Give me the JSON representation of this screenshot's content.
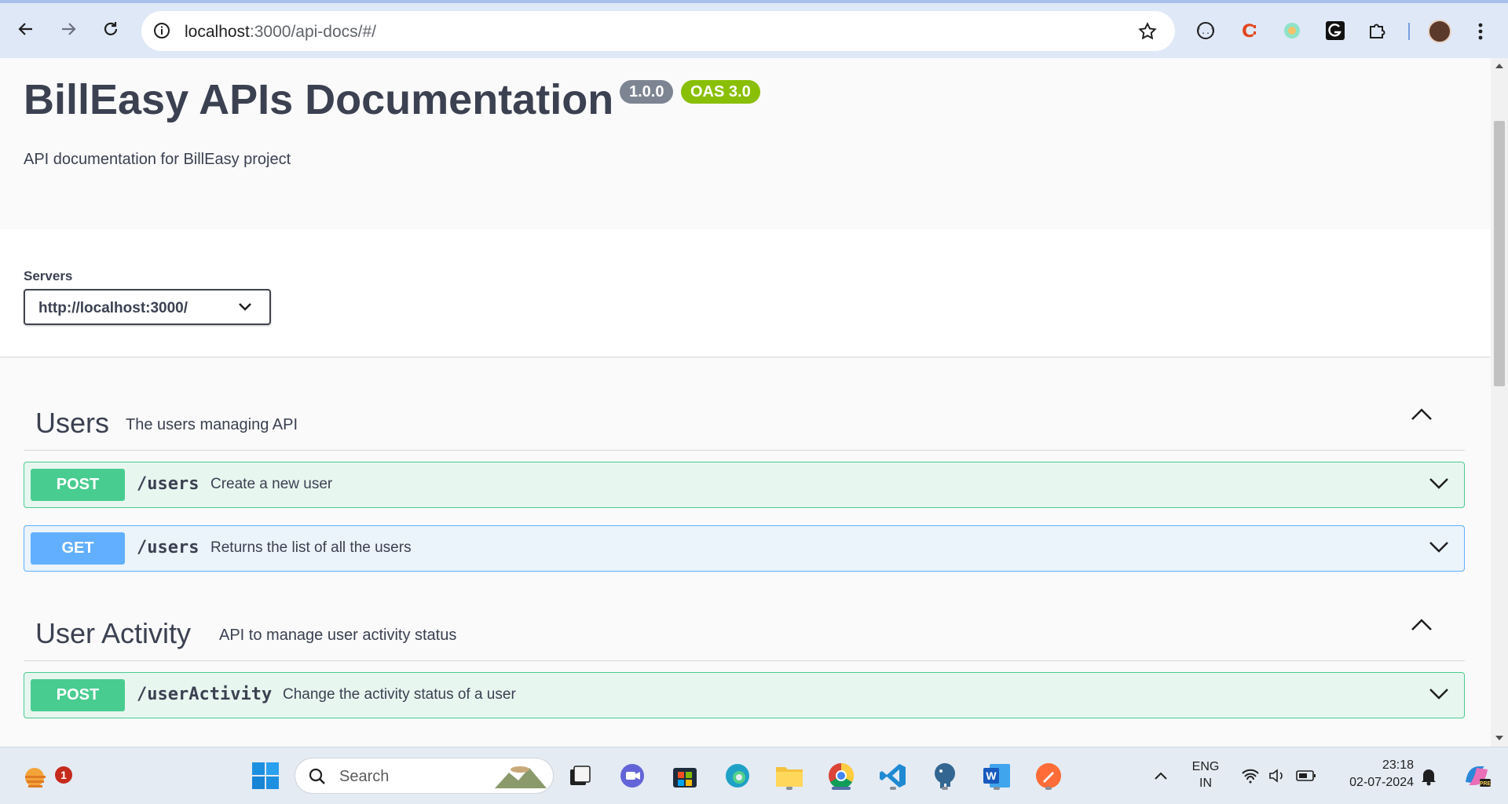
{
  "browser": {
    "url_host": "localhost",
    "url_path": ":3000/api-docs/#/",
    "back_icon": "arrow-left-icon",
    "forward_icon": "arrow-right-icon",
    "reload_icon": "reload-icon"
  },
  "info": {
    "title": "BillEasy APIs Documentation",
    "version": "1.0.0",
    "oas": "OAS 3.0",
    "description": "API documentation for BillEasy project"
  },
  "servers": {
    "label": "Servers",
    "selected": "http://localhost:3000/"
  },
  "tags": [
    {
      "name": "Users",
      "description": "The users managing API",
      "operations": [
        {
          "method": "POST",
          "path": "/users",
          "summary": "Create a new user"
        },
        {
          "method": "GET",
          "path": "/users",
          "summary": "Returns the list of all the users"
        }
      ]
    },
    {
      "name": "User Activity",
      "description": "API to manage user activity status",
      "operations": [
        {
          "method": "POST",
          "path": "/userActivity",
          "summary": "Change the activity status of a user"
        }
      ]
    }
  ],
  "taskbar": {
    "search_placeholder": "Search",
    "weather_badge": "1",
    "lang_top": "ENG",
    "lang_bottom": "IN",
    "time": "23:18",
    "date": "02-07-2024"
  },
  "colors": {
    "post": "#49cc90",
    "get": "#61affe",
    "text": "#3b4151",
    "oas_badge": "#89bf04",
    "version_badge": "#7d8492"
  }
}
